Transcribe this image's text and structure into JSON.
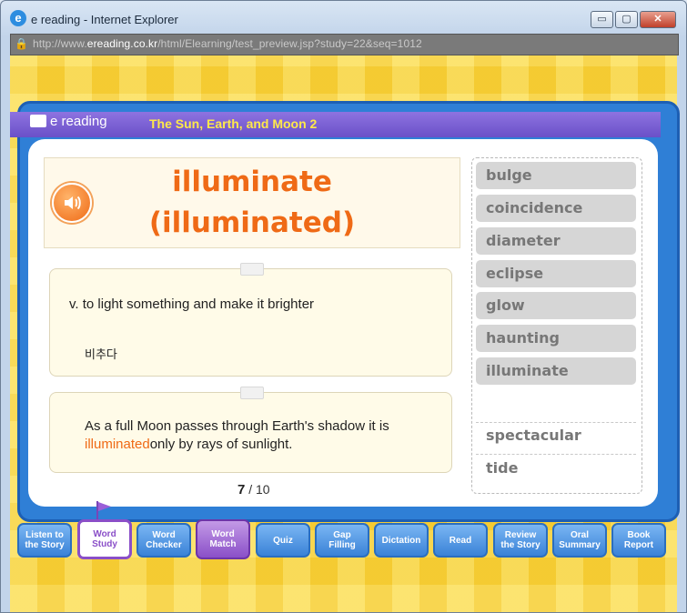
{
  "window": {
    "title": "e reading - Internet Explorer",
    "minimize": "▭",
    "maximize": "▢",
    "close": "✕"
  },
  "address": {
    "prefix": "http://www.",
    "domain": "ereading.co.kr",
    "path": "/html/Elearning/test_preview.jsp?study=22&seq=1012"
  },
  "app": {
    "logo": "e reading",
    "lesson_title": "The Sun, Earth, and Moon 2"
  },
  "word_card": {
    "line1": "illuminate",
    "line2": "(illuminated)"
  },
  "definition": {
    "text": "v. to light something and make it brighter",
    "korean": "비추다"
  },
  "example": {
    "before": "As a full Moon passes through Earth's shadow it is ",
    "highlight": "illuminated",
    "after": "only by rays of sunlight."
  },
  "pagination": {
    "current": "7",
    "separator": " / ",
    "total": "10"
  },
  "word_list": {
    "items": [
      "bulge",
      "coincidence",
      "diameter",
      "eclipse",
      "glow",
      "haunting",
      "illuminate"
    ],
    "remaining": [
      "spectacular",
      "tide"
    ]
  },
  "tabs": [
    {
      "line1": "Listen to",
      "line2": "the Story"
    },
    {
      "line1": "Word",
      "line2": "Study"
    },
    {
      "line1": "Word",
      "line2": "Checker"
    },
    {
      "line1": "Word",
      "line2": "Match"
    },
    {
      "line1": "Quiz",
      "line2": ""
    },
    {
      "line1": "Gap",
      "line2": "Filling"
    },
    {
      "line1": "Dictation",
      "line2": ""
    },
    {
      "line1": "Read",
      "line2": ""
    },
    {
      "line1": "Review",
      "line2": "the Story"
    },
    {
      "line1": "Oral",
      "line2": "Summary"
    },
    {
      "line1": "Book",
      "line2": "Report"
    }
  ],
  "colors": {
    "accent": "#ef6a16",
    "board": "#2f7fd6",
    "header": "#7a5fd4",
    "lesson_title": "#ffe94a",
    "background": "#f7d23d"
  }
}
